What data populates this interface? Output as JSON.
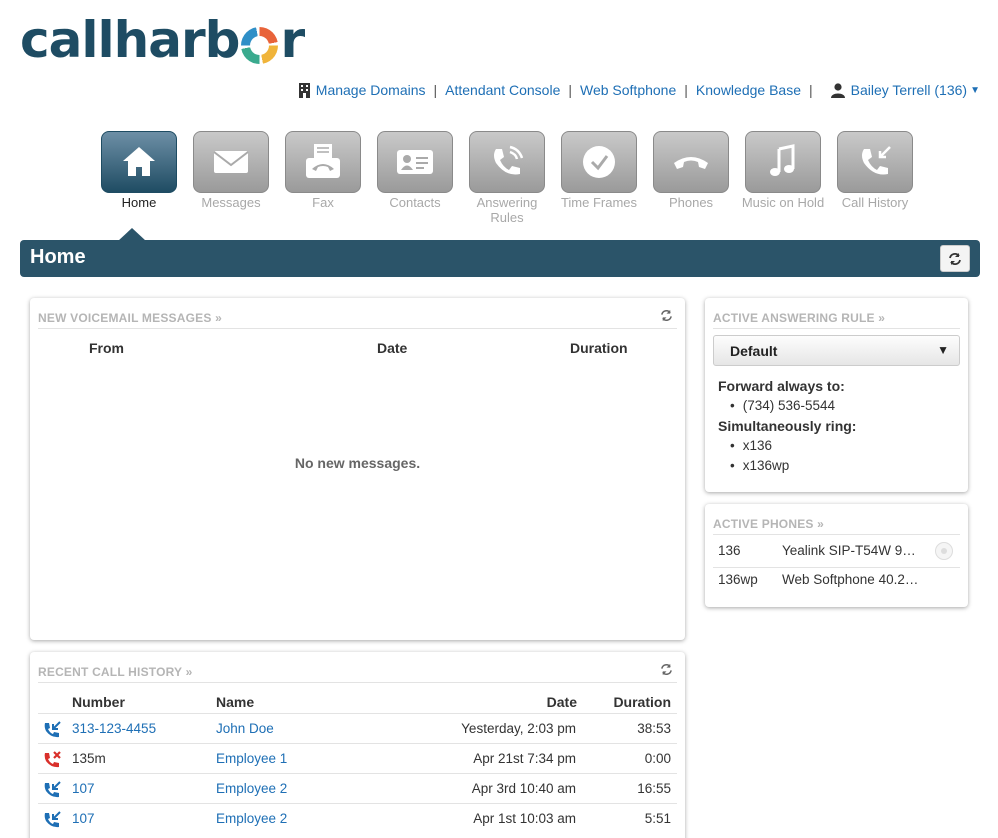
{
  "brand": {
    "logo_pre": "callharb",
    "logo_post": "r"
  },
  "topnav": {
    "links": [
      "Manage Domains",
      "Attendant Console",
      "Web Softphone",
      "Knowledge Base"
    ],
    "user": "Bailey Terrell (136)"
  },
  "toolbar": {
    "items": [
      {
        "label": "Home",
        "icon": "home-icon"
      },
      {
        "label": "Messages",
        "icon": "envelope-icon"
      },
      {
        "label": "Fax",
        "icon": "fax-icon"
      },
      {
        "label": "Contacts",
        "icon": "contact-card-icon"
      },
      {
        "label": "Answering Rules",
        "icon": "phone-ringing-icon"
      },
      {
        "label": "Time Frames",
        "icon": "clock-icon"
      },
      {
        "label": "Phones",
        "icon": "handset-icon"
      },
      {
        "label": "Music on Hold",
        "icon": "music-note-icon"
      },
      {
        "label": "Call History",
        "icon": "phone-history-icon"
      }
    ]
  },
  "page": {
    "title": "Home"
  },
  "voicemail": {
    "title": "NEW VOICEMAIL MESSAGES »",
    "columns": [
      "From",
      "Date",
      "Duration"
    ],
    "empty": "No new messages."
  },
  "call_history": {
    "title": "RECENT CALL HISTORY »",
    "columns": [
      "Number",
      "Name",
      "Date",
      "Duration"
    ],
    "rows": [
      {
        "type": "incoming",
        "number": "313-123-4455",
        "name": "John Doe",
        "date": "Yesterday, 2:03 pm",
        "duration": "38:53"
      },
      {
        "type": "missed",
        "number": "135m",
        "name": "Employee 1",
        "date": "Apr 21st 7:34 pm",
        "duration": "0:00"
      },
      {
        "type": "incoming",
        "number": "107",
        "name": "Employee 2",
        "date": "Apr 3rd 10:40 am",
        "duration": "16:55"
      },
      {
        "type": "incoming",
        "number": "107",
        "name": "Employee 2",
        "date": "Apr 1st 10:03 am",
        "duration": "5:51"
      }
    ]
  },
  "answering_rule": {
    "title": "ACTIVE ANSWERING RULE »",
    "selected": "Default",
    "forward_label": "Forward always to:",
    "forward_items": [
      "(734) 536-5544"
    ],
    "sim_label": "Simultaneously ring:",
    "sim_items": [
      "x136",
      "x136wp"
    ]
  },
  "phones": {
    "title": "ACTIVE PHONES »",
    "rows": [
      {
        "ext": "136",
        "device": "Yealink SIP-T54W 9…"
      },
      {
        "ext": "136wp",
        "device": "Web Softphone 40.2…"
      }
    ]
  },
  "colors": {
    "brand_dark": "#1e4c63",
    "header_bar": "#2b5469",
    "link": "#1e6fb5",
    "missed": "#d9302b"
  }
}
